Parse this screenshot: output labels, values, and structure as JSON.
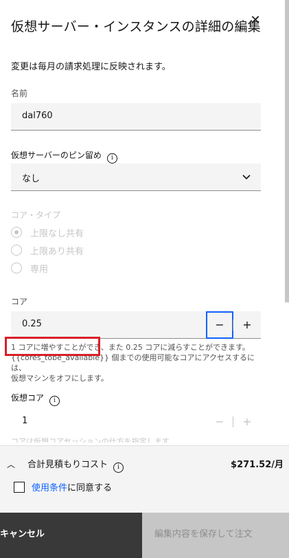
{
  "panel": {
    "title": "仮想サーバー・インスタンスの詳細の編集",
    "notice": "変更は毎月の請求処理に反映されます。"
  },
  "fields": {
    "name": {
      "label": "名前",
      "value": "dal760"
    },
    "pin": {
      "label": "仮想サーバーのピン留め",
      "value": "なし"
    },
    "core_type": {
      "label": "コア・タイプ",
      "options": [
        "上限なし共有",
        "上限あり共有",
        "専用"
      ],
      "selected": "上限なし共有"
    },
    "cores": {
      "label": "コア",
      "value": "0.25",
      "helper_line1": "1 コアに増やすことができ、また 0.25 コアに減らすことができます。",
      "helper_line2": "{{cores_tobe_available}} 個までの使用可能なコアにアクセスするには、",
      "helper_line3": "仮想マシンをオフにします。"
    },
    "vcores": {
      "label": "仮想コア",
      "value": "1",
      "clipped_text": "コアは仮想コアセッションの仕方を指定します"
    }
  },
  "summary": {
    "label": "合計見積もりコスト",
    "price": "$271.52/月",
    "terms_link": "使用条件",
    "terms_suffix": "に同意する"
  },
  "footer": {
    "cancel": "キャンセル",
    "save": "編集内容を保存して注文"
  },
  "icons": {
    "close": "close-icon",
    "info": "info-icon",
    "chevron_down": "chevron-down-icon",
    "chevron_up": "chevron-up-icon"
  },
  "colors": {
    "accent": "#0f62fe",
    "highlight": "#da1e28",
    "cancel_bg": "#393939",
    "save_disabled_bg": "#c6c6c6"
  }
}
